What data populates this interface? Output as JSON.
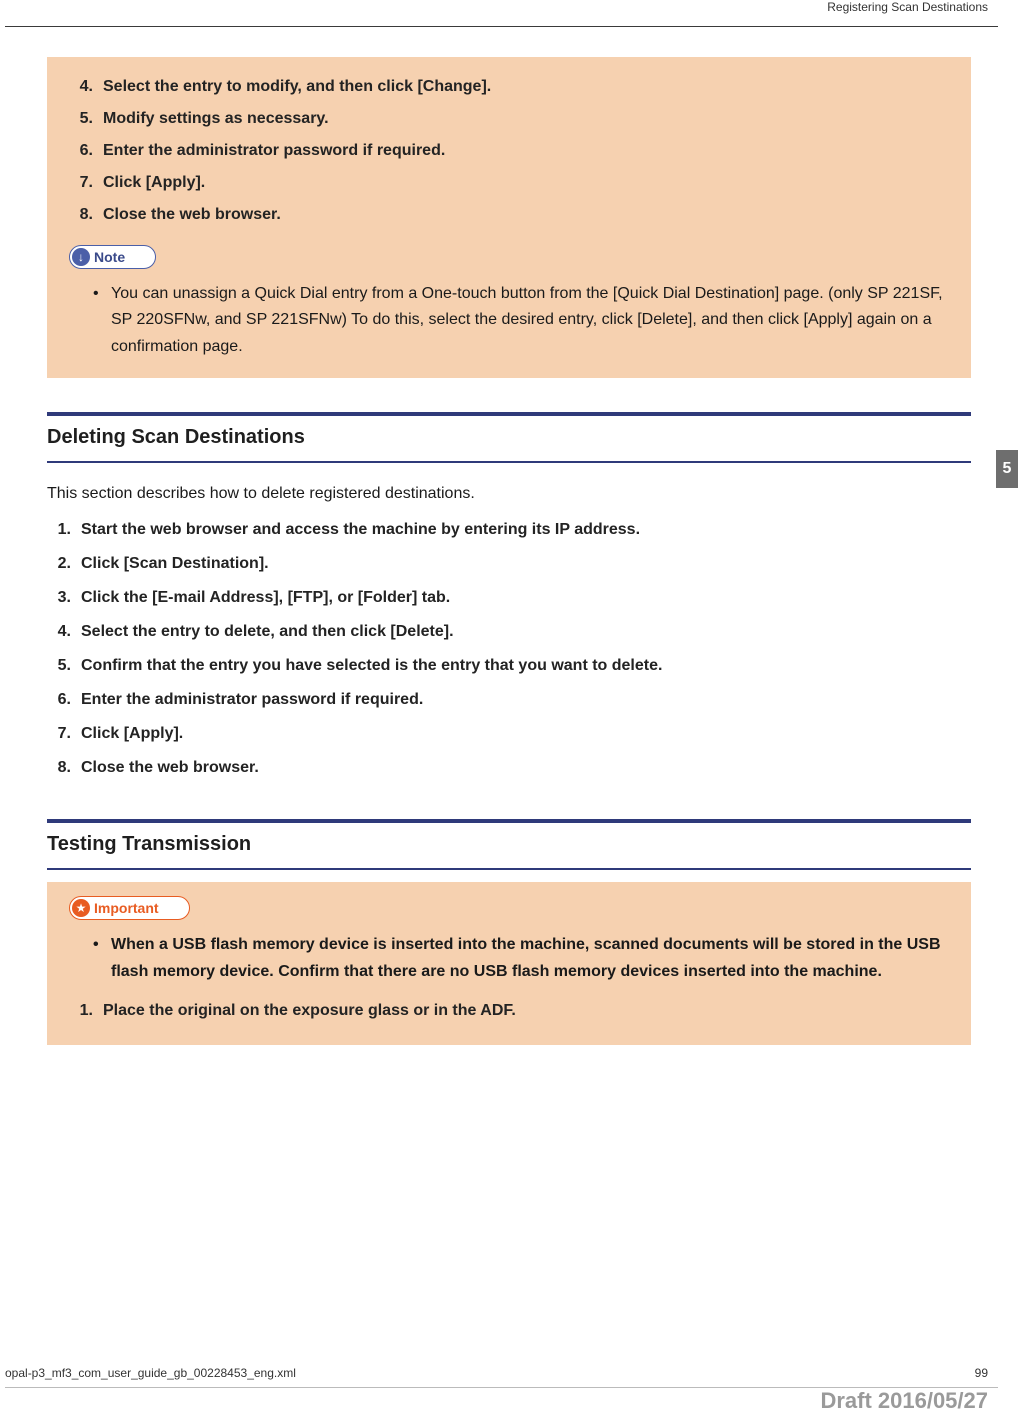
{
  "header": {
    "section_title": "Registering Scan Destinations"
  },
  "chapter_tab": "5",
  "box1": {
    "steps": [
      {
        "n": "4.",
        "t": "Select the entry to modify, and then click [Change]."
      },
      {
        "n": "5.",
        "t": "Modify settings as necessary."
      },
      {
        "n": "6.",
        "t": "Enter the administrator password if required."
      },
      {
        "n": "7.",
        "t": "Click [Apply]."
      },
      {
        "n": "8.",
        "t": "Close the web browser."
      }
    ],
    "note_label": "Note",
    "note_icon": "↓",
    "note_bullets": [
      "You can unassign a Quick Dial entry from a One-touch button from the [Quick Dial Destination] page. (only SP 221SF, SP 220SFNw, and SP 221SFNw) To do this, select the desired entry, click [Delete], and then click [Apply] again on a confirmation page."
    ]
  },
  "section_delete": {
    "title": "Deleting Scan Destinations",
    "intro": "This section describes how to delete registered destinations.",
    "steps": [
      {
        "n": "1.",
        "t": "Start the web browser and access the machine by entering its IP address."
      },
      {
        "n": "2.",
        "t": "Click [Scan Destination]."
      },
      {
        "n": "3.",
        "t": "Click the [E-mail Address], [FTP], or [Folder] tab."
      },
      {
        "n": "4.",
        "t": "Select the entry to delete, and then click [Delete]."
      },
      {
        "n": "5.",
        "t": "Confirm that the entry you have selected is the entry that you want to delete."
      },
      {
        "n": "6.",
        "t": "Enter the administrator password if required."
      },
      {
        "n": "7.",
        "t": "Click [Apply]."
      },
      {
        "n": "8.",
        "t": "Close the web browser."
      }
    ]
  },
  "section_test": {
    "title": "Testing Transmission",
    "important_label": "Important",
    "important_icon": "★",
    "bullets": [
      "When a USB flash memory device is inserted into the machine, scanned documents will be stored in the USB flash memory device. Confirm that there are no USB flash memory devices inserted into the machine."
    ],
    "steps": [
      {
        "n": "1.",
        "t": "Place the original on the exposure glass or in the ADF."
      }
    ]
  },
  "footer": {
    "file": "opal-p3_mf3_com_user_guide_gb_00228453_eng.xml",
    "page": "99",
    "draft": "Draft 2016/05/27"
  }
}
